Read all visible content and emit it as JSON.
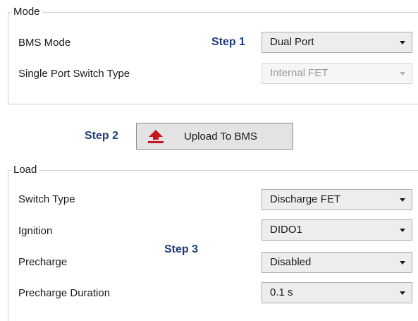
{
  "mode": {
    "legend": "Mode",
    "step1": "Step 1",
    "bms_mode": {
      "label": "BMS Mode",
      "value": "Dual Port"
    },
    "single_port_switch": {
      "label": "Single Port Switch Type",
      "value": "Internal FET"
    }
  },
  "upload": {
    "step2": "Step 2",
    "button_label": "Upload To BMS",
    "icon": "upload-icon"
  },
  "load": {
    "legend": "Load",
    "step3": "Step 3",
    "switch_type": {
      "label": "Switch Type",
      "value": "Discharge FET"
    },
    "ignition": {
      "label": "Ignition",
      "value": "DIDO1"
    },
    "precharge": {
      "label": "Precharge",
      "value": "Disabled"
    },
    "precharge_duration": {
      "label": "Precharge Duration",
      "value": "0.1 s"
    }
  },
  "colors": {
    "step_text": "#1f3c78",
    "upload_icon": "#c4161c"
  }
}
